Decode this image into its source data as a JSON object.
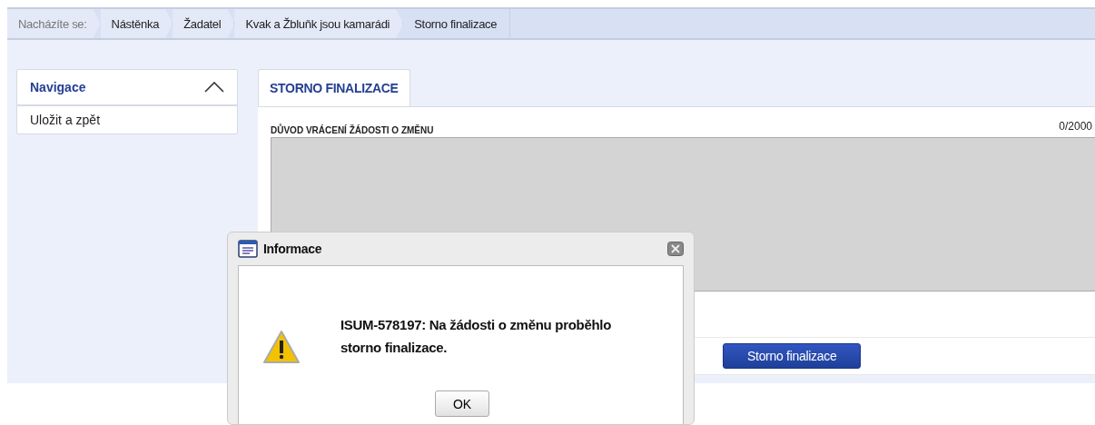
{
  "breadcrumb": {
    "label": "Nacházíte se:",
    "items": [
      "Nástěnka",
      "Žadatel",
      "Kvak a Žbluňk jsou kamarádi",
      "Storno finalizace"
    ]
  },
  "sidebar": {
    "title": "Navigace",
    "expanded": true,
    "items": [
      "Uložit a zpět"
    ]
  },
  "tabs": [
    {
      "label": "STORNO FINALIZACE",
      "selected": true
    }
  ],
  "field": {
    "label": "DŮVOD VRÁCENÍ ŽÁDOSTI O ZMĚNU",
    "counter": "0/2000"
  },
  "action_button": "Storno finalizace",
  "dialog": {
    "title": "Informace",
    "message": "ISUM-578197: Na žádosti o změnu proběhlo storno finalizace.",
    "button": "OK"
  }
}
